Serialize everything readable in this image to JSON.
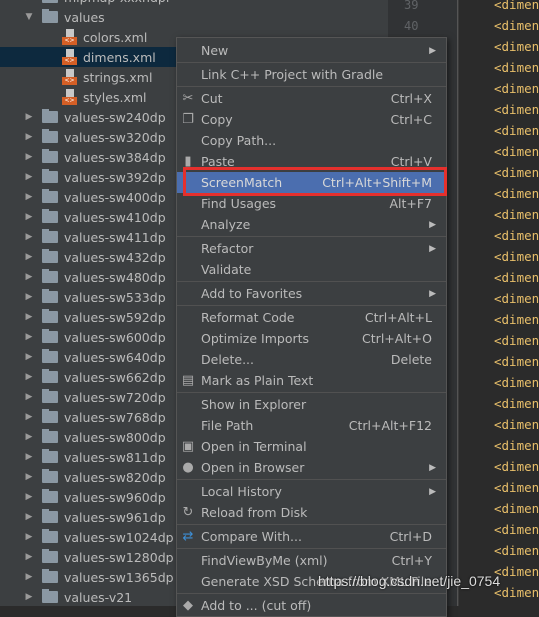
{
  "tree": {
    "partial_top": "mipmap-xxxhdpi",
    "values_folder": "values",
    "files": [
      "colors.xml",
      "dimens.xml",
      "strings.xml",
      "styles.xml"
    ],
    "selected_file": "dimens.xml",
    "folders": [
      "values-sw240dp",
      "values-sw320dp",
      "values-sw384dp",
      "values-sw392dp",
      "values-sw400dp",
      "values-sw410dp",
      "values-sw411dp",
      "values-sw432dp",
      "values-sw480dp",
      "values-sw533dp",
      "values-sw592dp",
      "values-sw600dp",
      "values-sw640dp",
      "values-sw662dp",
      "values-sw720dp",
      "values-sw768dp",
      "values-sw800dp",
      "values-sw811dp",
      "values-sw820dp",
      "values-sw960dp",
      "values-sw961dp",
      "values-sw1024dp",
      "values-sw1280dp",
      "values-sw1365dp",
      "values-v21"
    ]
  },
  "editor": {
    "line_numbers": [
      "39",
      "40"
    ],
    "code_line": "<dimen",
    "code_line_count": 29,
    "tag_color": "#e8bf6a"
  },
  "menu": {
    "highlight_color": "#4b6eaf",
    "items": [
      {
        "label": "New",
        "submenu": true
      },
      {
        "label": "Link C++ Project with Gradle"
      },
      {
        "label": "Cut",
        "shortcut": "Ctrl+X",
        "icon": "scissors-icon"
      },
      {
        "label": "Copy",
        "shortcut": "Ctrl+C",
        "icon": "copy-icon"
      },
      {
        "label": "Copy Path..."
      },
      {
        "label": "Paste",
        "shortcut": "Ctrl+V",
        "icon": "clipboard-icon"
      },
      {
        "label": "ScreenMatch",
        "shortcut": "Ctrl+Alt+Shift+M",
        "highlighted": true
      },
      {
        "label": "Find Usages",
        "shortcut": "Alt+F7"
      },
      {
        "label": "Analyze",
        "submenu": true
      },
      {
        "label": "Refactor",
        "submenu": true
      },
      {
        "label": "Validate"
      },
      {
        "label": "Add to Favorites",
        "submenu": true
      },
      {
        "label": "Reformat Code",
        "shortcut": "Ctrl+Alt+L"
      },
      {
        "label": "Optimize Imports",
        "shortcut": "Ctrl+Alt+O"
      },
      {
        "label": "Delete...",
        "shortcut": "Delete"
      },
      {
        "label": "Mark as Plain Text",
        "icon": "plain-text-icon"
      },
      {
        "label": "Show in Explorer"
      },
      {
        "label": "File Path",
        "shortcut": "Ctrl+Alt+F12"
      },
      {
        "label": "Open in Terminal",
        "icon": "terminal-icon"
      },
      {
        "label": "Open in Browser",
        "submenu": true,
        "icon": "globe-icon"
      },
      {
        "label": "Local History",
        "submenu": true
      },
      {
        "label": "Reload from Disk",
        "icon": "reload-icon"
      },
      {
        "label": "Compare With...",
        "shortcut": "Ctrl+D",
        "icon": "compare-icon"
      },
      {
        "label": "FindViewByMe (xml)",
        "shortcut": "Ctrl+Y"
      },
      {
        "label": "Generate XSD Schema from XML File..."
      },
      {
        "label": "Add to ... (cut off)",
        "icon": "add-icon"
      }
    ]
  },
  "watermark": "https://blog.csdn.net/jie_0754"
}
